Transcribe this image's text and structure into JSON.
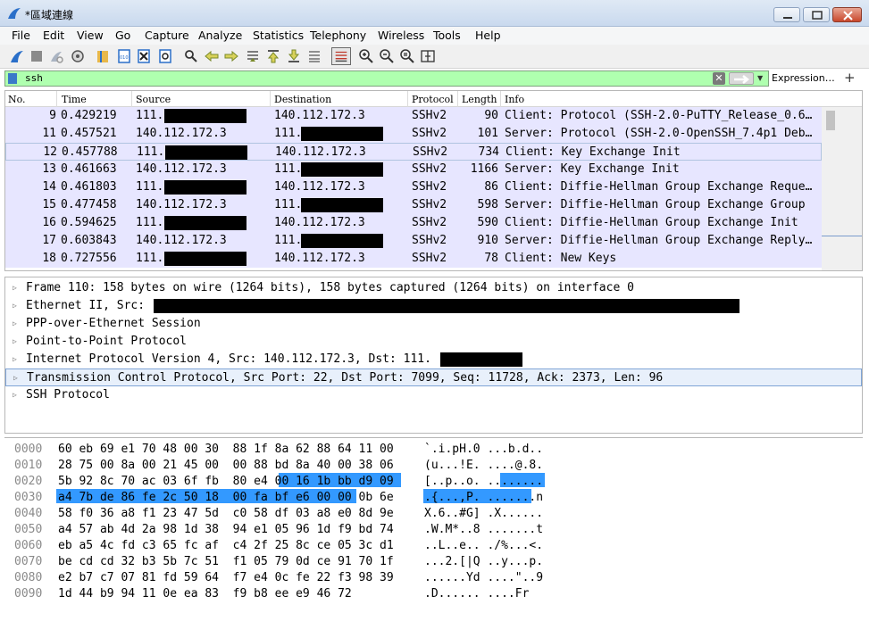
{
  "window": {
    "title": "*區域連線"
  },
  "menu": [
    "File",
    "Edit",
    "View",
    "Go",
    "Capture",
    "Analyze",
    "Statistics",
    "Telephony",
    "Wireless",
    "Tools",
    "Help"
  ],
  "toolbar_icons": [
    "shark-fin-start-icon",
    "stop-icon",
    "restart-icon",
    "options-gear-icon",
    "open-folder-icon",
    "save-icon",
    "close-file-icon",
    "reload-icon",
    "find-icon",
    "back-arrow-icon",
    "forward-arrow-icon",
    "go-to-packet-icon",
    "first-packet-icon",
    "last-packet-icon",
    "autoscroll-icon",
    "colorize-icon",
    "zoom-in-icon",
    "zoom-out-icon",
    "normal-size-icon",
    "resize-columns-icon"
  ],
  "filter": {
    "value": "ssh",
    "expression_label": "Expression…",
    "plus_label": "+",
    "clear_label": "✕",
    "dropdown_label": "▼"
  },
  "packet_list": {
    "columns": [
      "No.",
      "Time",
      "Source",
      "Destination",
      "Protocol",
      "Length",
      "Info"
    ],
    "rows": [
      {
        "no": "9",
        "time": "0.429219",
        "src": "111.",
        "dst": "140.112.172.3",
        "proto": "SSHv2",
        "len": "90",
        "info": "Client: Protocol (SSH-2.0-PuTTY_Release_0.6…"
      },
      {
        "no": "11",
        "time": "0.457521",
        "src": "140.112.172.3",
        "dst": "111.",
        "proto": "SSHv2",
        "len": "101",
        "info": "Server: Protocol (SSH-2.0-OpenSSH_7.4p1 Deb…"
      },
      {
        "no": "12",
        "time": "0.457788",
        "src": "111.",
        "dst": "140.112.172.3",
        "proto": "SSHv2",
        "len": "734",
        "info": "Client: Key Exchange Init"
      },
      {
        "no": "13",
        "time": "0.461663",
        "src": "140.112.172.3",
        "dst": "111.",
        "proto": "SSHv2",
        "len": "1166",
        "info": "Server: Key Exchange Init"
      },
      {
        "no": "14",
        "time": "0.461803",
        "src": "111.",
        "dst": "140.112.172.3",
        "proto": "SSHv2",
        "len": "86",
        "info": "Client: Diffie-Hellman Group Exchange Reque…"
      },
      {
        "no": "15",
        "time": "0.477458",
        "src": "140.112.172.3",
        "dst": "111.",
        "proto": "SSHv2",
        "len": "598",
        "info": "Server: Diffie-Hellman Group Exchange Group"
      },
      {
        "no": "16",
        "time": "0.594625",
        "src": "111.",
        "dst": "140.112.172.3",
        "proto": "SSHv2",
        "len": "590",
        "info": "Client: Diffie-Hellman Group Exchange Init"
      },
      {
        "no": "17",
        "time": "0.603843",
        "src": "140.112.172.3",
        "dst": "111.",
        "proto": "SSHv2",
        "len": "910",
        "info": "Server: Diffie-Hellman Group Exchange Reply…"
      },
      {
        "no": "18",
        "time": "0.727556",
        "src": "111.",
        "dst": "140.112.172.3",
        "proto": "SSHv2",
        "len": "78",
        "info": "Client: New Keys"
      }
    ],
    "row_color": "#e7e6ff"
  },
  "details": [
    "Frame 110: 158 bytes on wire (1264 bits), 158 bytes captured (1264 bits) on interface 0",
    "Ethernet II, Src:",
    "PPP-over-Ethernet Session",
    "Point-to-Point Protocol",
    "Internet Protocol Version 4, Src: 140.112.172.3, Dst: 111.",
    "Transmission Control Protocol, Src Port: 22, Dst Port: 7099, Seq: 11728, Ack: 2373, Len: 96",
    "SSH Protocol"
  ],
  "bytes": [
    {
      "off": "0000",
      "hex": "60 eb 69 e1 70 48 00 30  88 1f 8a 62 88 64 11 00",
      "ascii": "`.i.pH.0 ...b.d.."
    },
    {
      "off": "0010",
      "hex": "28 75 00 8a 00 21 45 00  00 88 bd 8a 40 00 38 06",
      "ascii": "(u...!E. ....@.8."
    },
    {
      "off": "0020",
      "hex": "5b 92 8c 70 ac 03 6f fb  80 e4 00 16 1b bb d9 09",
      "ascii": "[..p..o. ........"
    },
    {
      "off": "0030",
      "hex": "a4 7b de 86 fe 2c 50 18  00 fa bf e6 00 00 0b 6e",
      "ascii": ".{...,P. .......n"
    },
    {
      "off": "0040",
      "hex": "58 f0 36 a8 f1 23 47 5d  c0 58 df 03 a8 e0 8d 9e",
      "ascii": "X.6..#G] .X......"
    },
    {
      "off": "0050",
      "hex": "a4 57 ab 4d 2a 98 1d 38  94 e1 05 96 1d f9 bd 74",
      "ascii": ".W.M*..8 .......t"
    },
    {
      "off": "0060",
      "hex": "eb a5 4c fd c3 65 fc af  c4 2f 25 8c ce 05 3c d1",
      "ascii": "..L..e.. ./%...<."
    },
    {
      "off": "0070",
      "hex": "be cd cd 32 b3 5b 7c 51  f1 05 79 0d ce 91 70 1f",
      "ascii": "...2.[|Q ..y...p."
    },
    {
      "off": "0080",
      "hex": "e2 b7 c7 07 81 fd 59 64  f7 e4 0c fe 22 f3 98 39",
      "ascii": "......Yd ....\"..9"
    },
    {
      "off": "0090",
      "hex": "1d 44 b9 94 11 0e ea 83  f9 b8 ee e9 46 72",
      "ascii": ".D...... ....Fr"
    }
  ],
  "colors": {
    "filter_bg": "#afffaf",
    "selection": "#3399ff",
    "row_bg": "#e7e6ff"
  }
}
